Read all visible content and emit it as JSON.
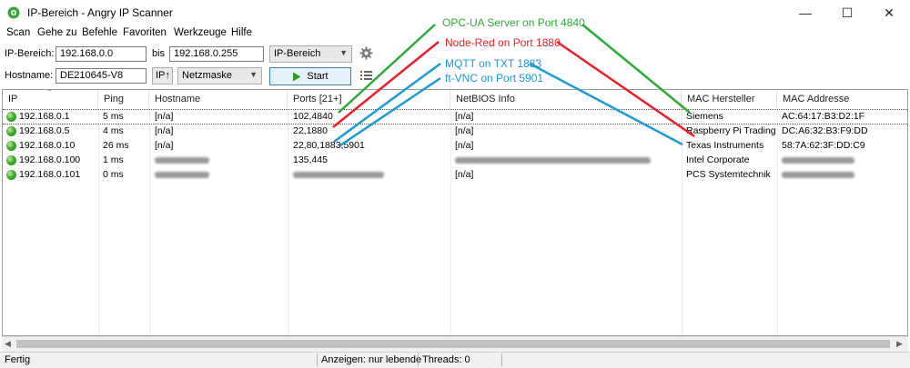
{
  "window": {
    "title": "IP-Bereich - Angry IP Scanner",
    "min": "—",
    "max": "☐",
    "close": "✕"
  },
  "menu": [
    "Scan",
    "Gehe zu",
    "Befehle",
    "Favoriten",
    "Werkzeuge",
    "Hilfe"
  ],
  "toolbar": {
    "range_label": "IP-Bereich:",
    "from_ip": "192.168.0.0",
    "bis_label": "bis",
    "to_ip": "192.168.0.255",
    "feeder_select": "IP-Bereich",
    "hostname_label": "Hostname:",
    "hostname_value": "DE210645-V8",
    "ip_button": "IP↑",
    "netmask_select": "Netzmaske",
    "start_label": "Start"
  },
  "table": {
    "columns": [
      "IP",
      "Ping",
      "Hostname",
      "Ports [21+]",
      "NetBIOS Info",
      "MAC Hersteller",
      "MAC Addresse"
    ],
    "rows": [
      {
        "ip": "192.168.0.1",
        "ping": "5 ms",
        "hostname": "[n/a]",
        "ports": "102,4840",
        "netbios": "[n/a]",
        "vendor": "Siemens",
        "mac": "AC:64:17:B3:D2:1F"
      },
      {
        "ip": "192.168.0.5",
        "ping": "4 ms",
        "hostname": "[n/a]",
        "ports": "22,1880",
        "netbios": "[n/a]",
        "vendor": "Raspberry Pi Trading",
        "mac": "DC:A6:32:B3:F9:DD"
      },
      {
        "ip": "192.168.0.10",
        "ping": "26 ms",
        "hostname": "[n/a]",
        "ports": "22,80,1883,5901",
        "netbios": "[n/a]",
        "vendor": "Texas Instruments",
        "mac": "58:7A:62:3F:DD:C9"
      },
      {
        "ip": "192.168.0.100",
        "ping": "1 ms",
        "hostname": "",
        "ports": "135,445",
        "netbios": "",
        "vendor": "Intel Corporate",
        "mac": ""
      },
      {
        "ip": "192.168.0.101",
        "ping": "0 ms",
        "hostname": "",
        "ports": "",
        "netbios": "[n/a]",
        "vendor": "PCS Systemtechnik",
        "mac": ""
      }
    ]
  },
  "annotations": [
    {
      "text": "OPC-UA Server on Port 4840",
      "color": "#2eaa3a"
    },
    {
      "text": "Node-Red on Port 1880",
      "color": "#e8202a"
    },
    {
      "text": "MQTT on TXT 1883",
      "color": "#1a9ad6"
    },
    {
      "text": "ft-VNC on Port 5901",
      "color": "#1a9ad6"
    }
  ],
  "status": {
    "left": "Fertig",
    "display": "Anzeigen: nur lebende",
    "threads": "Threads: 0"
  },
  "icons": {
    "app": "angry-ip-icon",
    "settings": "gear-icon",
    "fetchers": "list-icon",
    "start": "play-icon",
    "alive": "green-dot-icon"
  }
}
